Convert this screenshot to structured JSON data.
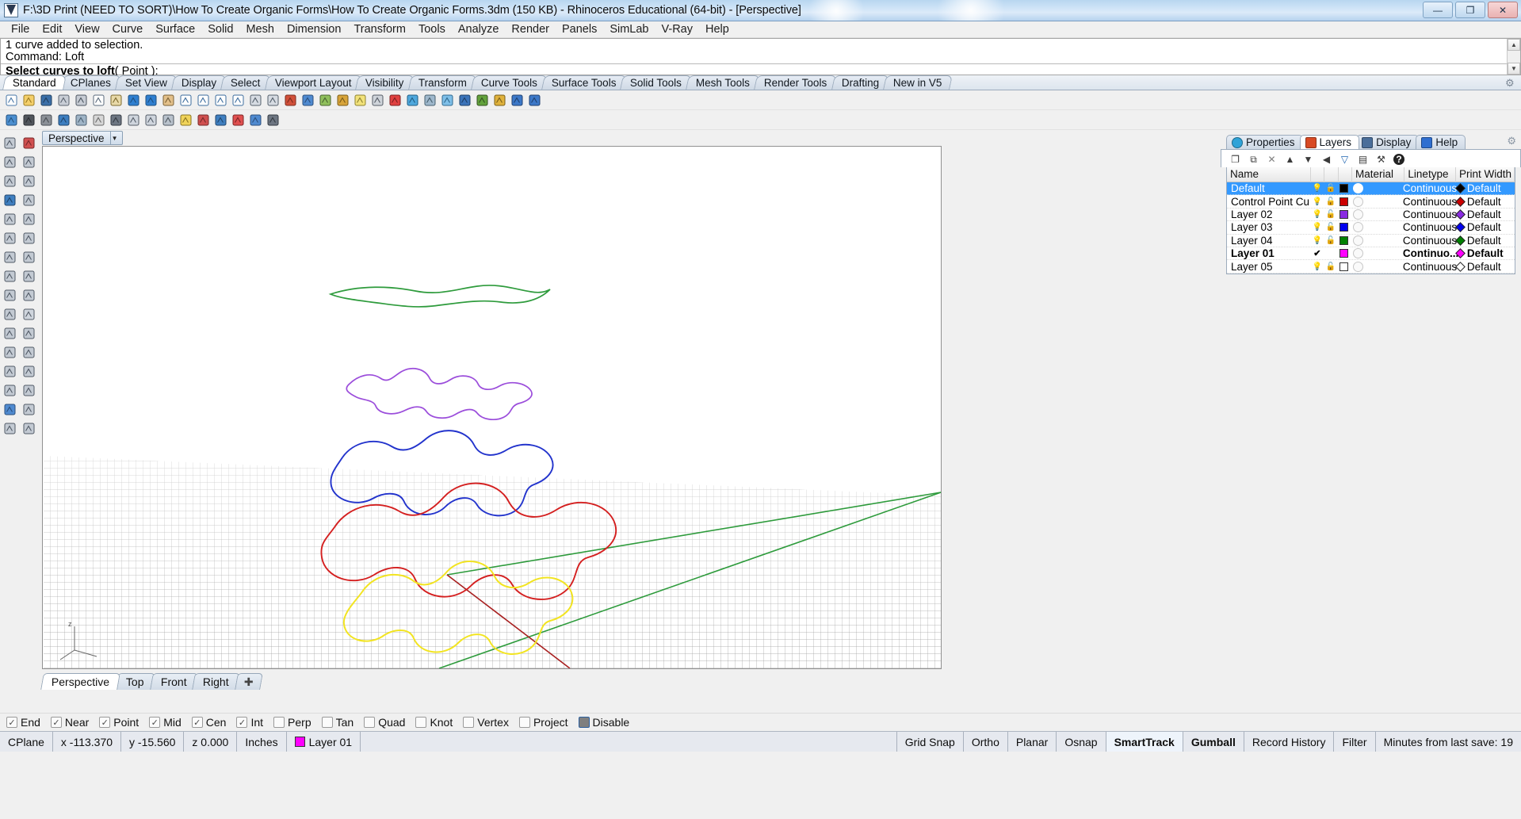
{
  "window": {
    "title": "F:\\3D Print (NEED TO SORT)\\How To Create Organic Forms\\How To Create Organic Forms.3dm (150 KB) - Rhinoceros Educational (64-bit) - [Perspective]",
    "minimize_label": "—",
    "restore_label": "❐",
    "close_label": "✕"
  },
  "menubar": {
    "items": [
      "File",
      "Edit",
      "View",
      "Curve",
      "Surface",
      "Solid",
      "Mesh",
      "Dimension",
      "Transform",
      "Tools",
      "Analyze",
      "Render",
      "Panels",
      "SimLab",
      "V-Ray",
      "Help"
    ]
  },
  "command_area": {
    "history": [
      "1 curve added to selection.",
      "Command: Loft"
    ],
    "prompt_bold": "Select curves to loft",
    "prompt_open": "( ",
    "prompt_option_pre": "",
    "prompt_option_underlined": "P",
    "prompt_option_rest": "oint",
    "prompt_close": " ):",
    "scroll_up": "▲",
    "scroll_down": "▼"
  },
  "toolbar_tabs": {
    "active": "Standard",
    "items": [
      "Standard",
      "CPlanes",
      "Set View",
      "Display",
      "Select",
      "Viewport Layout",
      "Visibility",
      "Transform",
      "Curve Tools",
      "Surface Tools",
      "Solid Tools",
      "Mesh Tools",
      "Render Tools",
      "Drafting",
      "New in V5"
    ],
    "settings_icon": "gear-icon"
  },
  "toolbar_row1": [
    "new-file-icon",
    "open-file-icon",
    "save-file-icon",
    "print-icon",
    "cut-icon",
    "copy-icon",
    "paste-icon",
    "undo-icon",
    "redo-icon",
    "pan-icon",
    "zoom-icon",
    "zoom-window-icon",
    "zoom-extents-icon",
    "zoom-selected-icon",
    "grid-snap-icon",
    "grid-icon",
    "render-icon",
    "render-preview-icon",
    "history-icon",
    "layer-icon",
    "light-icon",
    "lock-icon",
    "color-icon",
    "color-wheel-icon",
    "material-icon",
    "environment-icon",
    "sphere-icon",
    "bird-icon",
    "options-icon",
    "help-arrow-icon",
    "help-icon"
  ],
  "toolbar_row2": [
    "globe-icon",
    "shade-icon",
    "ghost-icon",
    "wireframe-icon",
    "xray-icon",
    "rendered-icon",
    "camera-icon",
    "layout-icon",
    "split-icon",
    "box-icon",
    "sun-icon",
    "point-icon",
    "curve-icon",
    "select-curve-icon",
    "analyze-icon",
    "display-icon"
  ],
  "left_rail": [
    "select-icon",
    "point-icon",
    "line-icon",
    "polyline-icon",
    "circle-icon",
    "arc-icon",
    "curve-icon",
    "rectangle-icon",
    "surface-icon",
    "extrude-icon",
    "box-solid-icon",
    "sphere-solid-icon",
    "cylinder-icon",
    "revolve-icon",
    "mesh-icon",
    "boolean-icon",
    "fillet-icon",
    "chamfer-icon",
    "trim-icon",
    "split-icon",
    "text-icon",
    "dimension-icon",
    "array-icon",
    "mirror-icon",
    "scale-icon",
    "rotate-icon",
    "block-icon",
    "group-icon",
    "analyze-icon",
    "check-icon",
    "render-tool-icon",
    "light-tool-icon"
  ],
  "viewport": {
    "name": "Perspective",
    "dropdown_caret": "▼",
    "axis_label": "z",
    "tabs": [
      "Perspective",
      "Top",
      "Front",
      "Right"
    ],
    "active_tab": "Perspective",
    "add_tab_label": "✚"
  },
  "curves": {
    "green": "#2e9b3c",
    "purple": "#9b4ddb",
    "blue": "#2233cc",
    "red": "#d41f1f",
    "yellow": "#f2e422",
    "axis_green": "#2e9b3c",
    "axis_red": "#a82020"
  },
  "panel": {
    "tabs": [
      {
        "label": "Properties",
        "icon": "color-wheel-icon"
      },
      {
        "label": "Layers",
        "icon": "layers-icon"
      },
      {
        "label": "Display",
        "icon": "monitor-icon"
      },
      {
        "label": "Help",
        "icon": "help-icon"
      }
    ],
    "active_tab": "Layers",
    "settings_icon": "gear-icon",
    "toolbar_icons": [
      "new-layer-icon",
      "copy-layer-icon",
      "delete-layer-icon",
      "move-up-icon",
      "move-down-icon",
      "move-left-icon",
      "filter-icon",
      "properties-icon",
      "tools-icon",
      "help-icon"
    ],
    "columns": [
      "Name",
      "",
      "",
      "",
      "",
      "Material",
      "Linetype",
      "",
      "Print Width"
    ],
    "layers": [
      {
        "name": "Default",
        "visible": true,
        "locked": false,
        "color": "#000000",
        "material_on": true,
        "linetype": "Continuous",
        "print_width": "Default",
        "pw_color": "#000000",
        "selected": true,
        "current": false
      },
      {
        "name": "Control Point Cu...",
        "visible": true,
        "locked": false,
        "color": "#cc0000",
        "material_on": false,
        "linetype": "Continuous",
        "print_width": "Default",
        "pw_color": "#cc0000",
        "selected": false,
        "current": false
      },
      {
        "name": "Layer 02",
        "visible": true,
        "locked": false,
        "color": "#8a2be2",
        "material_on": false,
        "linetype": "Continuous",
        "print_width": "Default",
        "pw_color": "#8a2be2",
        "selected": false,
        "current": false
      },
      {
        "name": "Layer 03",
        "visible": true,
        "locked": false,
        "color": "#0000ee",
        "material_on": false,
        "linetype": "Continuous",
        "print_width": "Default",
        "pw_color": "#0000ee",
        "selected": false,
        "current": false
      },
      {
        "name": "Layer 04",
        "visible": true,
        "locked": false,
        "color": "#008000",
        "material_on": false,
        "linetype": "Continuous",
        "print_width": "Default",
        "pw_color": "#008000",
        "selected": false,
        "current": false
      },
      {
        "name": "Layer 01",
        "visible": false,
        "locked": false,
        "color": "#ff00ff",
        "material_on": false,
        "linetype": "Continuo...",
        "print_width": "Default",
        "pw_color": "#ff00ff",
        "selected": false,
        "current": true
      },
      {
        "name": "Layer 05",
        "visible": true,
        "locked": false,
        "color": "#ffffff",
        "material_on": false,
        "linetype": "Continuous",
        "print_width": "Default",
        "pw_color": "#ffffff",
        "selected": false,
        "current": false
      }
    ],
    "current_check": "✔"
  },
  "osnaps": [
    {
      "label": "End",
      "checked": true
    },
    {
      "label": "Near",
      "checked": true
    },
    {
      "label": "Point",
      "checked": true
    },
    {
      "label": "Mid",
      "checked": true
    },
    {
      "label": "Cen",
      "checked": true
    },
    {
      "label": "Int",
      "checked": true
    },
    {
      "label": "Perp",
      "checked": false
    },
    {
      "label": "Tan",
      "checked": false
    },
    {
      "label": "Quad",
      "checked": false
    },
    {
      "label": "Knot",
      "checked": false
    },
    {
      "label": "Vertex",
      "checked": false
    },
    {
      "label": "Project",
      "checked": false
    },
    {
      "label": "Disable",
      "checked": false,
      "grey": true
    }
  ],
  "statusbar": {
    "cplane": "CPlane",
    "x": "x -113.370",
    "y": "y -15.560",
    "z": "z 0.000",
    "units": "Inches",
    "layer": "Layer 01",
    "layer_color": "#ff00ff",
    "grid_snap": "Grid Snap",
    "ortho": "Ortho",
    "planar": "Planar",
    "osnap": "Osnap",
    "smarttrack": "SmartTrack",
    "gumball": "Gumball",
    "record_history": "Record History",
    "filter": "Filter",
    "save_info": "Minutes from last save: 19"
  }
}
